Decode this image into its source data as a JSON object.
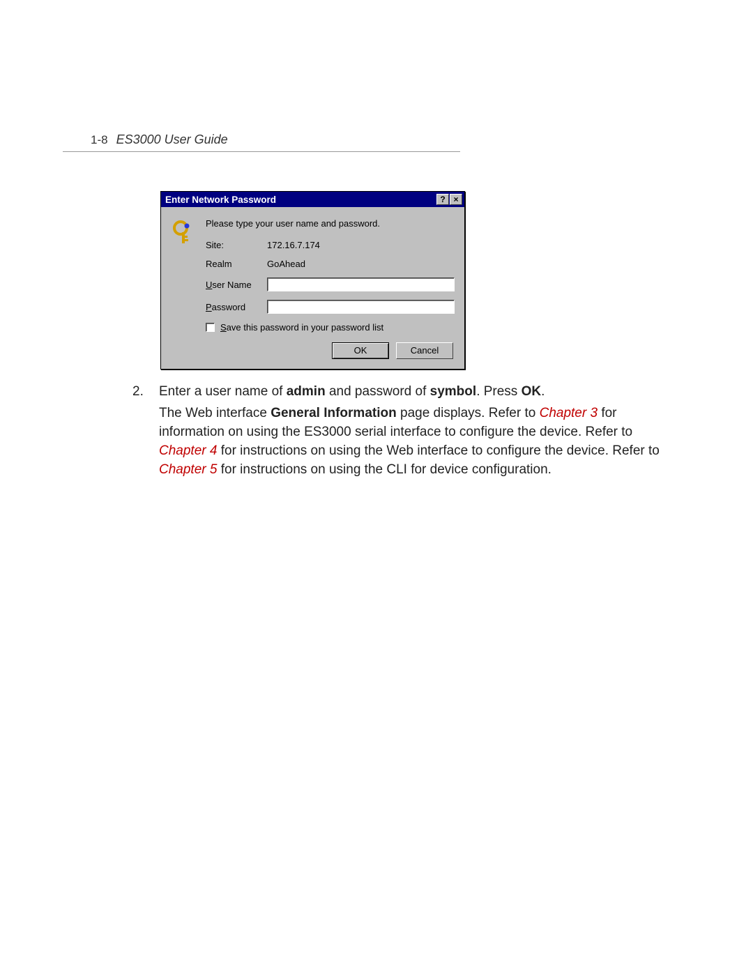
{
  "header": {
    "page_num": "1-8",
    "title": "ES3000 User Guide"
  },
  "dialog": {
    "title": "Enter Network Password",
    "help_btn": "?",
    "close_btn": "×",
    "instruction": "Please type your user name and password.",
    "site_label": "Site:",
    "site_value": "172.16.7.174",
    "realm_label": "Realm",
    "realm_value": "GoAhead",
    "user_label_pre": "U",
    "user_label_rest": "ser Name",
    "pass_label_pre": "P",
    "pass_label_rest": "assword",
    "save_pre": "S",
    "save_rest": "ave this password in your password list",
    "ok_btn": "OK",
    "cancel_btn": "Cancel"
  },
  "step": {
    "number": "2.",
    "line1_a": "Enter a user name of ",
    "line1_admin": "admin",
    "line1_b": " and password of ",
    "line1_symbol": "symbol",
    "line1_c": ". Press ",
    "line1_ok": "OK",
    "line1_d": ".",
    "line2_a": "The Web interface ",
    "line2_gi": "General Information",
    "line2_b": " page displays. Refer to ",
    "ch3": "Chapter 3",
    "line2_c": " for information on using the ES3000 serial interface to configure the device. Refer to ",
    "ch4": "Chapter 4",
    "line2_d": " for instructions on using the Web interface to configure the device. Refer to ",
    "ch5": "Chapter 5",
    "line2_e": " for instructions on using the CLI for device configuration."
  }
}
